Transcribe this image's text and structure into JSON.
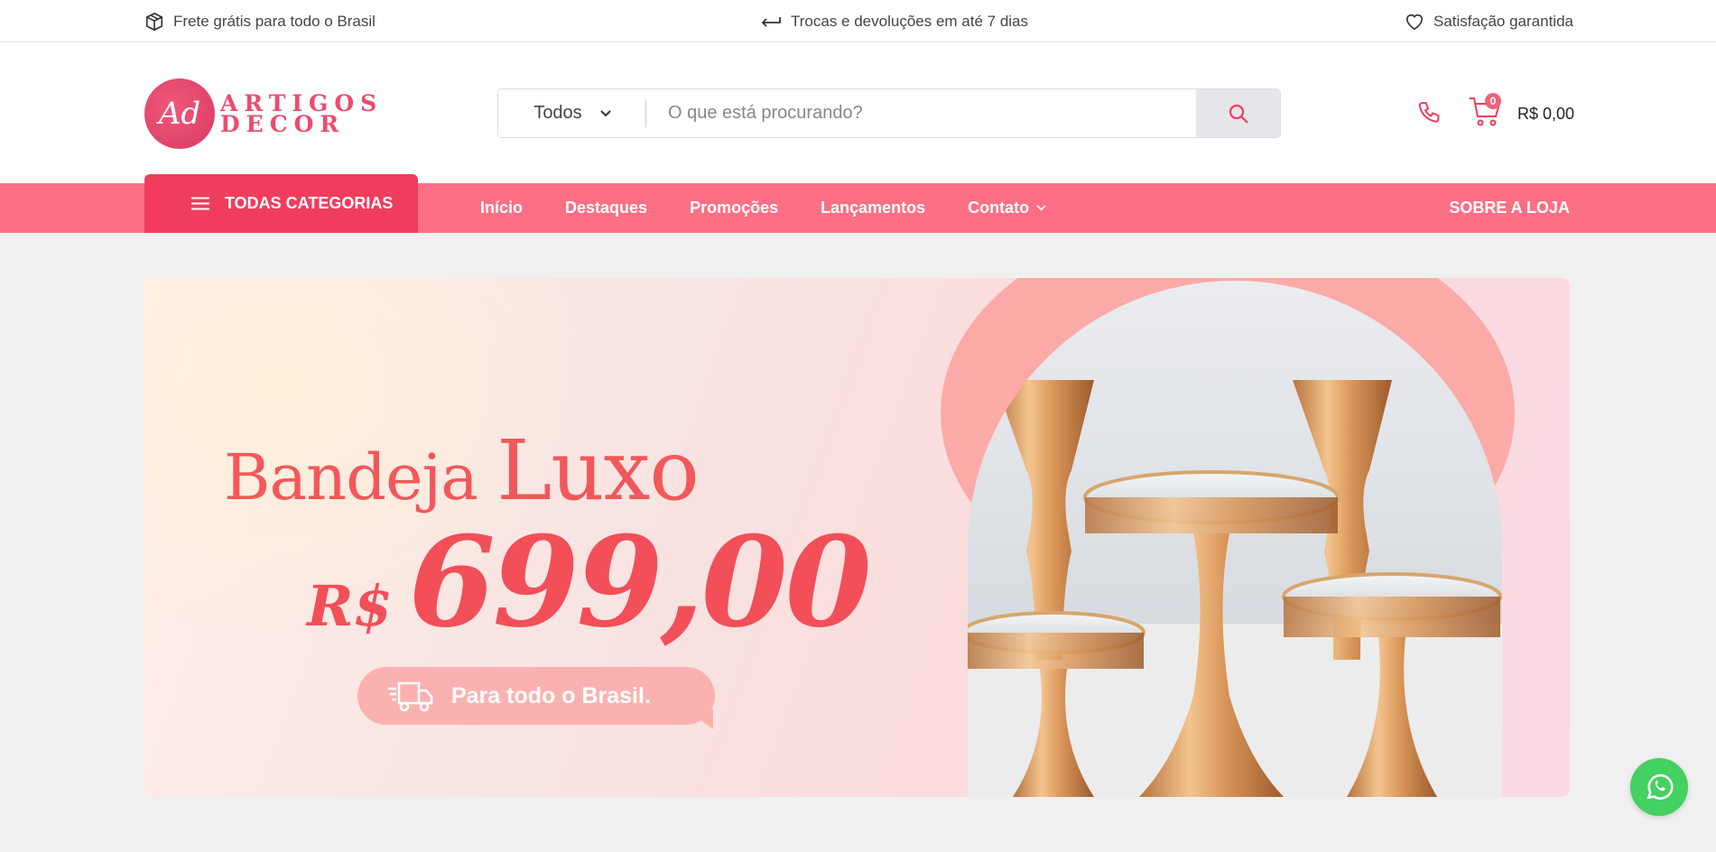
{
  "topbar": {
    "shipping": "Frete grátis para todo o Brasil",
    "returns": "Trocas e devoluções em até 7 dias",
    "satisfaction": "Satisfação garantida"
  },
  "header": {
    "logo_mark": "Ad",
    "logo_line1": "ARTIGOS",
    "logo_line2": "DECOR",
    "search": {
      "category": "Todos",
      "placeholder": "O que está procurando?"
    },
    "cart": {
      "count": "0",
      "total": "R$ 0,00"
    }
  },
  "nav": {
    "all_categories": "TODAS CATEGORIAS",
    "links": [
      "Início",
      "Destaques",
      "Promoções",
      "Lançamentos",
      "Contato"
    ],
    "about": "SOBRE A LOJA"
  },
  "banner": {
    "title_word1": "Bandeja",
    "title_word2": "Luxo",
    "currency": "R$",
    "price": "699,00",
    "pill": "Para todo o Brasil."
  },
  "colors": {
    "brand": "#fc6f84",
    "brand_dark": "#f03d5d",
    "accent_red": "#f24f59",
    "whatsapp": "#43d161"
  }
}
